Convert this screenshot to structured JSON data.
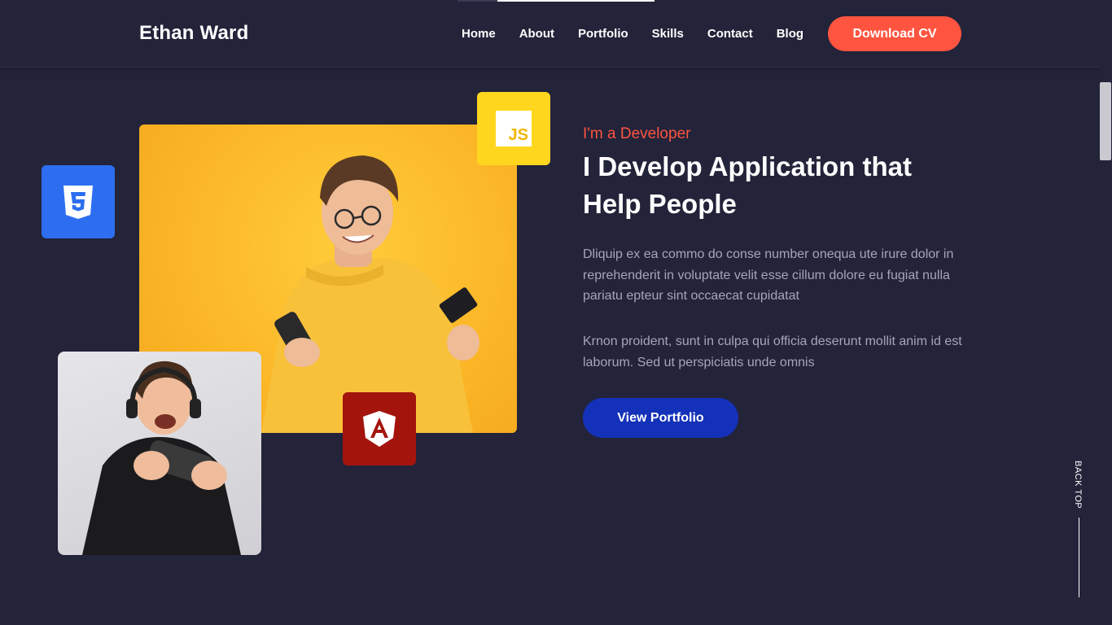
{
  "header": {
    "brand": "Ethan Ward",
    "nav": [
      "Home",
      "About",
      "Portfolio",
      "Skills",
      "Contact",
      "Blog"
    ],
    "cta": "Download CV"
  },
  "hero": {
    "eyebrow": "I'm a Developer",
    "headline": "I Develop Application that Help People",
    "paragraphs": [
      "Dliquip ex ea commo do conse number onequa ute irure dolor in reprehenderit in voluptate velit esse cillum dolore eu fugiat nulla pariatu epteur sint occaecat cupidatat",
      "Krnon proident, sunt in culpa qui officia deserunt mollit anim id est laborum. Sed ut perspiciatis unde omnis"
    ],
    "button": "View Portfolio",
    "badges": {
      "js": "JS"
    }
  },
  "back_top": "BACK TOP",
  "colors": {
    "background": "#23233a",
    "accent": "#ff5440",
    "button_blue": "#1431b9",
    "css_badge": "#2d6ef0",
    "js_badge": "#ffd61e",
    "angular_badge": "#a3140d",
    "photo_yellow": "#fbb627"
  }
}
